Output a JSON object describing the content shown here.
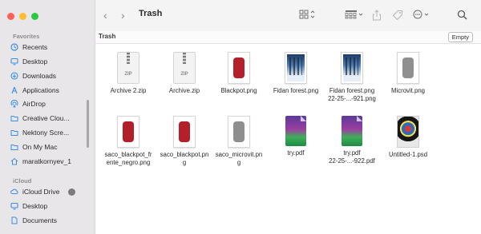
{
  "window": {
    "title": "Trash",
    "path_label": "Trash",
    "empty_button": "Empty"
  },
  "sidebar": {
    "favorites_title": "Favorites",
    "icloud_title": "iCloud",
    "favorites": [
      {
        "label": "Recents",
        "icon": "clock-icon"
      },
      {
        "label": "Desktop",
        "icon": "desktop-icon"
      },
      {
        "label": "Downloads",
        "icon": "download-icon"
      },
      {
        "label": "Applications",
        "icon": "applications-icon"
      },
      {
        "label": "AirDrop",
        "icon": "airdrop-icon"
      },
      {
        "label": "Creative Clou...",
        "icon": "folder-icon"
      },
      {
        "label": "Nektony Scre...",
        "icon": "folder-icon"
      },
      {
        "label": "On My Mac",
        "icon": "folder-icon"
      },
      {
        "label": "maratkornyev_1",
        "icon": "home-icon"
      }
    ],
    "icloud": [
      {
        "label": "iCloud Drive",
        "icon": "cloud-icon"
      },
      {
        "label": "Desktop",
        "icon": "desktop-icon"
      },
      {
        "label": "Documents",
        "icon": "document-icon"
      }
    ]
  },
  "files": [
    {
      "line1": "Archive 2.zip",
      "line2": "",
      "kind": "zip"
    },
    {
      "line1": "Archive.zip",
      "line2": "",
      "kind": "zip"
    },
    {
      "line1": "Blackpot.png",
      "line2": "",
      "kind": "red-packet"
    },
    {
      "line1": "Fidan forest.png",
      "line2": "",
      "kind": "forest"
    },
    {
      "line1": "Fidan forest.png",
      "line2": "22-25-...-921.png",
      "kind": "forest"
    },
    {
      "line1": "Microvit.png",
      "line2": "",
      "kind": "gray-packet"
    },
    {
      "line1": "saco_blackpot_fr",
      "line2": "ente_negro.png",
      "kind": "red-packet"
    },
    {
      "line1": "saco_blackpot.pn",
      "line2": "g",
      "kind": "red-packet"
    },
    {
      "line1": "saco_microvit.pn",
      "line2": "g",
      "kind": "gray-packet"
    },
    {
      "line1": "try.pdf",
      "line2": "",
      "kind": "pdf"
    },
    {
      "line1": "try.pdf",
      "line2": "22-25-...-922.pdf",
      "kind": "pdf"
    },
    {
      "line1": "Untitled-1.psd",
      "line2": "",
      "kind": "psd"
    }
  ],
  "thumb_labels": {
    "zip": "ZIP"
  },
  "colors": {
    "close": "#fe5f57",
    "minimize": "#febc2e",
    "zoom": "#28c840",
    "sidebar_icon": "#3a8ee6",
    "red_packet": "#b3202a",
    "gray_packet": "#8f8f8f"
  }
}
